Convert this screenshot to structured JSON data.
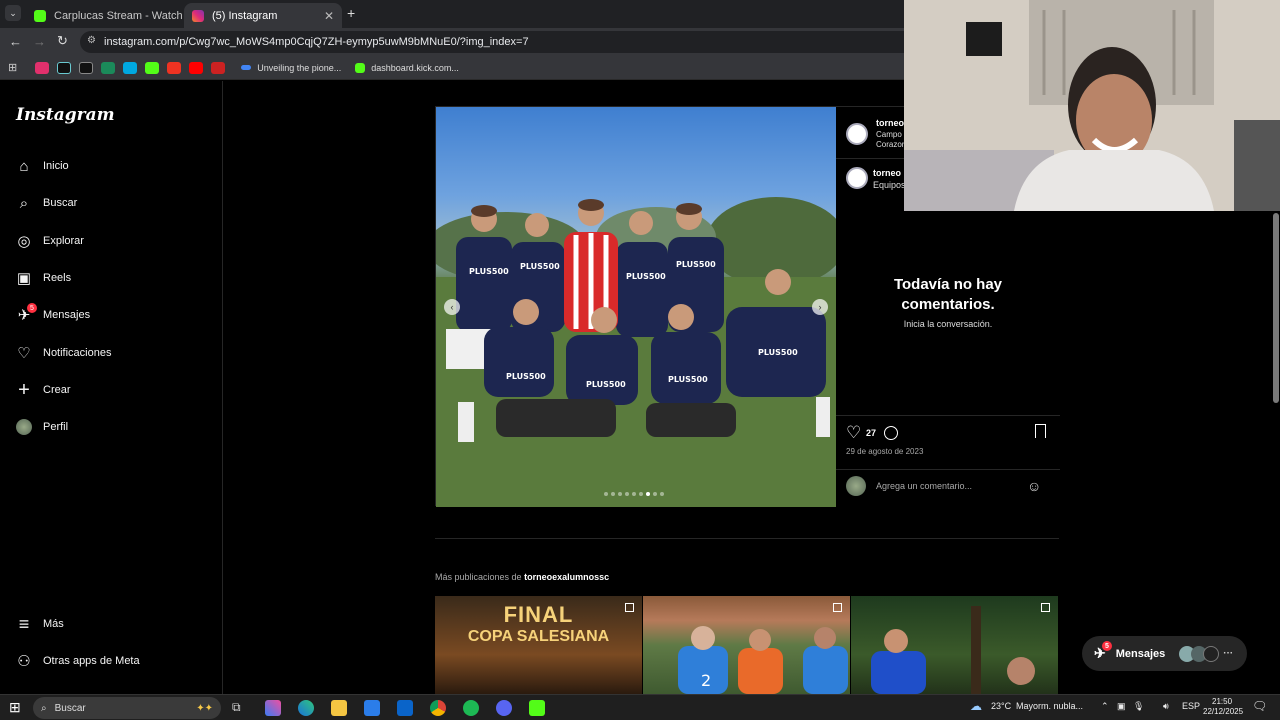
{
  "browser": {
    "tabs": [
      {
        "title": "Carplucas Stream - Watch Live",
        "color": "#53fc18"
      },
      {
        "title": "(5) Instagram",
        "color": "#e1306c"
      }
    ],
    "url": "instagram.com/p/Cwg7wc_MoWS4mp0CqjQ7ZH-eymyp5uwM9bMNuE0/?img_index=7",
    "bookmarks": [
      {
        "label": "Unveiling the pione...",
        "color": "#4285f4"
      },
      {
        "label": "dashboard.kick.com...",
        "color": "#53fc18"
      }
    ]
  },
  "instagram": {
    "logo": "Instagram",
    "nav": [
      {
        "label": "Inicio",
        "icon": "home-icon",
        "glyph": "⌂"
      },
      {
        "label": "Buscar",
        "icon": "search-icon",
        "glyph": "⌕"
      },
      {
        "label": "Explorar",
        "icon": "compass-icon",
        "glyph": "◎"
      },
      {
        "label": "Reels",
        "icon": "reels-icon",
        "glyph": "▣"
      },
      {
        "label": "Mensajes",
        "icon": "messenger-icon",
        "glyph": "✈",
        "badge": "5"
      },
      {
        "label": "Notificaciones",
        "icon": "heart-icon",
        "glyph": "♡"
      },
      {
        "label": "Crear",
        "icon": "plus-icon",
        "glyph": "+"
      },
      {
        "label": "Perfil",
        "icon": "avatar-icon",
        "glyph": "●"
      }
    ],
    "bottom_nav": [
      {
        "label": "Más",
        "icon": "menu-icon",
        "glyph": "≡"
      },
      {
        "label": "Otras apps de Meta",
        "icon": "meta-apps-icon",
        "glyph": "⚇"
      }
    ],
    "post": {
      "author_short": "torneo",
      "author_location_1": "Campo I",
      "author_location_2": "Corazon",
      "caption_author_short": "torneo",
      "caption_short": "Equipos",
      "no_comments": "Todavía no hay comentarios.",
      "start_conversation": "Inicia la conversación.",
      "likes": "27",
      "date": "29 de agosto de 2023",
      "add_comment_placeholder": "Agrega un comentario...",
      "carousel_current": 7,
      "carousel_total": 9
    },
    "more_posts_label": "Más publicaciones de",
    "more_posts_user": "torneoexalumnossc",
    "thumbs": [
      {
        "line1": "FINAL",
        "line2": "COPA SALESIANA"
      },
      {
        "jersey_numbers": [
          "2"
        ]
      },
      {}
    ],
    "messages_pill": "Mensajes",
    "messages_badge": "5"
  },
  "taskbar": {
    "search": "Buscar",
    "weather": "23°C",
    "weather_text": "Mayorm. nubla...",
    "lang": "ESP",
    "time": "21:50",
    "date": "22/12/2025"
  }
}
